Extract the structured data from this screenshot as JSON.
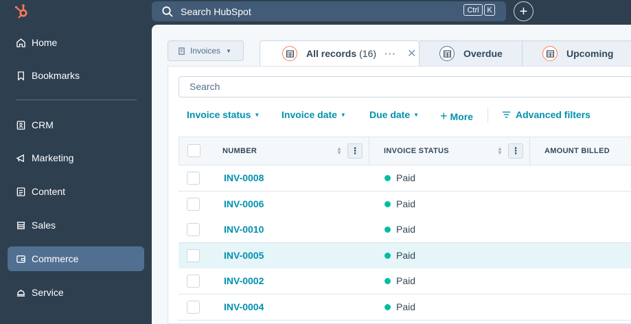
{
  "topbar": {
    "search_placeholder": "Search HubSpot",
    "shortcut_ctrl": "Ctrl",
    "shortcut_k": "K",
    "add_label": "+"
  },
  "sidebar": {
    "items": [
      {
        "label": "Home",
        "icon": "home-icon"
      },
      {
        "label": "Bookmarks",
        "icon": "bookmark-icon"
      },
      {
        "label": "CRM",
        "icon": "contacts-icon"
      },
      {
        "label": "Marketing",
        "icon": "megaphone-icon"
      },
      {
        "label": "Content",
        "icon": "document-icon"
      },
      {
        "label": "Sales",
        "icon": "sales-icon"
      },
      {
        "label": "Commerce",
        "icon": "wallet-icon",
        "active": true
      },
      {
        "label": "Service",
        "icon": "service-icon"
      }
    ]
  },
  "object_selector": {
    "label": "Invoices"
  },
  "tabs": [
    {
      "label": "All records",
      "count": "(16)",
      "active": true
    },
    {
      "label": "Overdue"
    },
    {
      "label": "Upcoming"
    }
  ],
  "search": {
    "placeholder": "Search"
  },
  "filters": {
    "invoice_status": "Invoice status",
    "invoice_date": "Invoice date",
    "due_date": "Due date",
    "more": "More",
    "advanced": "Advanced filters"
  },
  "table": {
    "columns": [
      "NUMBER",
      "INVOICE STATUS",
      "AMOUNT BILLED"
    ],
    "rows": [
      {
        "number": "INV-0008",
        "status": "Paid"
      },
      {
        "number": "INV-0006",
        "status": "Paid"
      },
      {
        "number": "INV-0010",
        "status": "Paid"
      },
      {
        "number": "INV-0005",
        "status": "Paid"
      },
      {
        "number": "INV-0002",
        "status": "Paid"
      },
      {
        "number": "INV-0004",
        "status": "Paid"
      }
    ]
  },
  "colors": {
    "brand_orange": "#ff7a59",
    "link_teal": "#0091ae",
    "status_green": "#00bda5",
    "sidebar_bg": "#2e3f50"
  }
}
